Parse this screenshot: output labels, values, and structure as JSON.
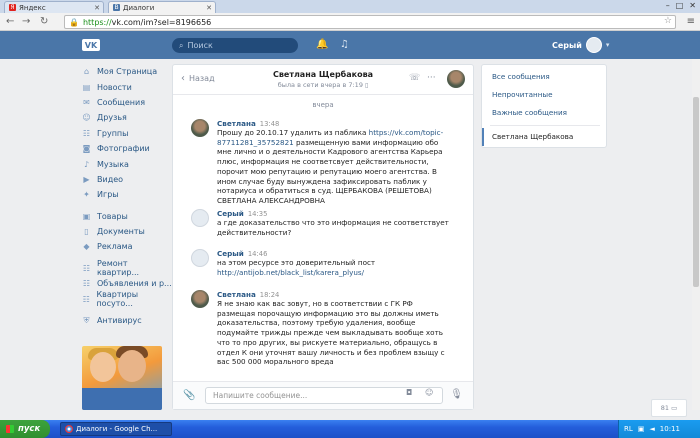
{
  "browser": {
    "tabs": [
      {
        "title": "Яндекс",
        "favicon": "Я",
        "favicon_color": "#e0231f"
      },
      {
        "title": "Диалоги",
        "favicon": "В",
        "favicon_color": "#4a76a8"
      }
    ],
    "url_https": "https://",
    "url_rest": "vk.com/im?sel=8196656"
  },
  "vk_header": {
    "logo": "VK",
    "search_placeholder": "Поиск",
    "user_name": "Серый"
  },
  "left_menu": {
    "items": [
      {
        "label": "Моя Страница",
        "icon": "home-icon"
      },
      {
        "label": "Новости",
        "icon": "news-icon"
      },
      {
        "label": "Сообщения",
        "icon": "messages-icon"
      },
      {
        "label": "Друзья",
        "icon": "friends-icon"
      },
      {
        "label": "Группы",
        "icon": "groups-icon"
      },
      {
        "label": "Фотографии",
        "icon": "photos-icon"
      },
      {
        "label": "Музыка",
        "icon": "music-icon"
      },
      {
        "label": "Видео",
        "icon": "video-icon"
      },
      {
        "label": "Игры",
        "icon": "games-icon"
      }
    ],
    "items2": [
      {
        "label": "Товары",
        "icon": "goods-icon"
      },
      {
        "label": "Документы",
        "icon": "documents-icon"
      },
      {
        "label": "Реклама",
        "icon": "ads-icon"
      }
    ],
    "items3": [
      {
        "label": "Ремонт квартир...",
        "icon": "community-icon"
      },
      {
        "label": "Объявления и р...",
        "icon": "community-icon"
      },
      {
        "label": "Квартиры посуто...",
        "icon": "community-icon"
      }
    ],
    "items4": [
      {
        "label": "Антивирус",
        "icon": "antivirus-icon"
      }
    ]
  },
  "chat": {
    "back_label": "Назад",
    "peer_name": "Светлана Щербакова",
    "peer_status": "была в сети вчера в 7:19",
    "date_separator": "вчера",
    "messages": [
      {
        "author": "Светлана",
        "time": "13:48",
        "text_before": "Прошу до 20.10.17 удалить из паблика ",
        "link": "https://vk.com/topic-87711281_35752821",
        "text_after": " размещенную вами информацию обо мне лично и о деятельности Кадрового агентства Карьера плюс, информация не соответсвует действительности, порочит мою репутацию и репутацию моего агентства. В ином случае буду вынуждена зафиксировать паблик у нотариуса и обратиться в суд. ЩЕРБАКОВА (РЕШЕТОВА) СВЕТЛАНА АЛЕКСАНДРОВНА"
      },
      {
        "author": "Серый",
        "time": "14:35",
        "text_before": "а где доказательство что это информация не соответствует действительности?",
        "link": "",
        "text_after": ""
      },
      {
        "author": "Серый",
        "time": "14:46",
        "text_before": "на этом ресурсе это доверительный пост ",
        "link": "http://antijob.net/black_list/karera_plyus/",
        "text_after": ""
      },
      {
        "author": "Светлана",
        "time": "18:24",
        "text_before": "Я не знаю как вас зовут, но в соответствии с ГК РФ размещая порочащую информацию это вы должны иметь доказательства, поэтому требую удаления, вообще подумайте трижды прежде чем выкладывать вообще хоть что то про других, вы рискуете материально, обращусь в отдел К они уточнят вашу личность и без проблем взыщу с вас 500 000 морального вреда",
        "link": "",
        "text_after": ""
      }
    ],
    "composer_placeholder": "Напишите сообщение..."
  },
  "right_panel": {
    "items": [
      "Все сообщения",
      "Непрочитанные",
      "Важные сообщения"
    ],
    "active": "Светлана Щербакова"
  },
  "mini_chat": {
    "count": "81"
  },
  "taskbar": {
    "start": "пуск",
    "task": "Диалоги - Google Ch...",
    "lang": "RL",
    "clock": "10:11"
  },
  "colors": {
    "vk_blue": "#4a76a8",
    "link": "#2a5885",
    "page_bg": "#edeef0"
  }
}
